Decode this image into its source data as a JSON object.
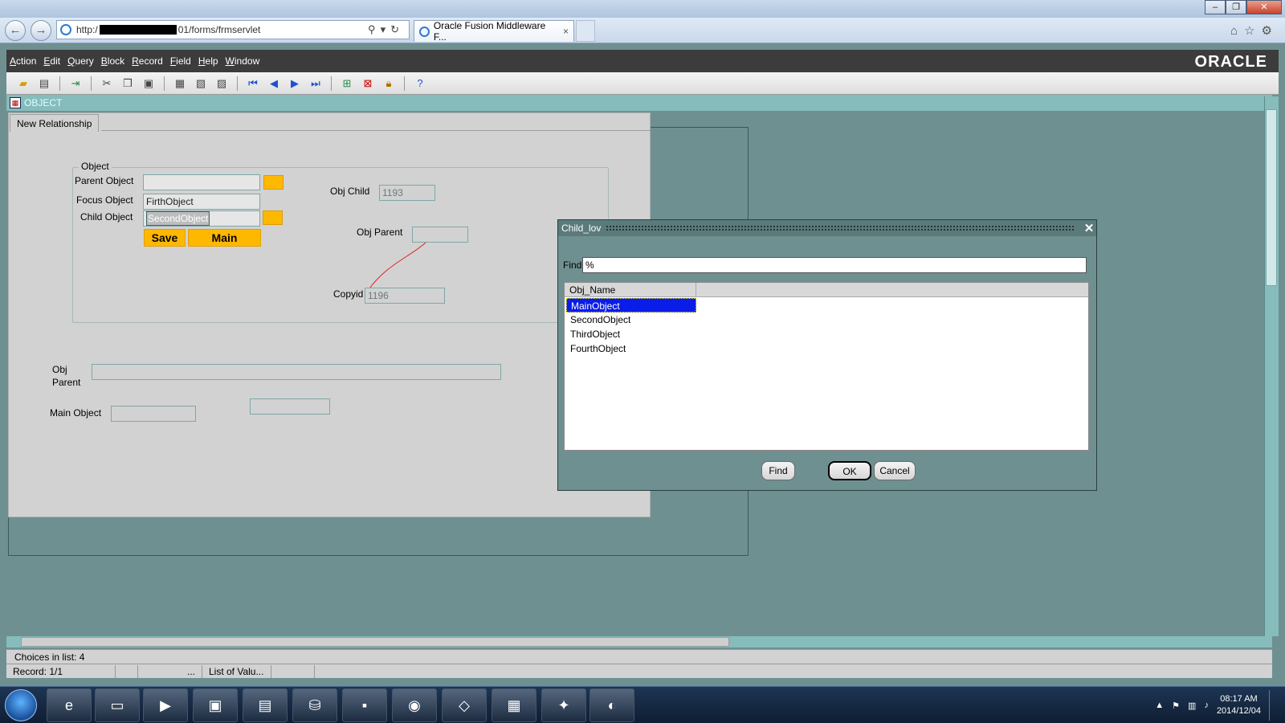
{
  "browser": {
    "url_prefix": "http:/",
    "url_suffix": "01/forms/frmservlet",
    "tab_title": "Oracle Fusion Middleware F...",
    "tab_close": "×",
    "window_buttons": {
      "minimize": "–",
      "maximize": "❐",
      "close": "✕"
    },
    "nav_back": "←",
    "nav_forward": "→",
    "address_tools": "⚲▾↻",
    "right_tools": "⌂☆⚙"
  },
  "app": {
    "menus": [
      "Action",
      "Edit",
      "Query",
      "Block",
      "Record",
      "Field",
      "Help",
      "Window"
    ],
    "menu_accel": [
      "A",
      "E",
      "Q",
      "B",
      "R",
      "F",
      "H",
      "W"
    ],
    "menu_rest": [
      "ction",
      "dit",
      "uery",
      "lock",
      "ecord",
      "ield",
      "elp",
      "indow"
    ],
    "logo": "ORACLE",
    "window_title": "OBJECT",
    "toolbar_icons": [
      "open-icon",
      "print-icon",
      "exit-icon",
      "cut-icon",
      "copy-icon",
      "paste-icon",
      "enter-query-icon",
      "execute-query-icon",
      "cancel-query-icon",
      "first-record-icon",
      "previous-record-icon",
      "next-record-icon",
      "last-record-icon",
      "insert-record-icon",
      "delete-record-icon",
      "lock-record-icon",
      "help-icon"
    ],
    "toolbar_help": "?"
  },
  "form": {
    "tab_label": "New Relationship",
    "group_label": "Object",
    "parent_object_label": "Parent Object",
    "parent_object_value": "",
    "focus_object_label": "Focus Object",
    "focus_object_value": "FirthObject",
    "child_object_label": "Child Object",
    "child_object_value": "SecondObject",
    "save_label": "Save",
    "main_label": "Main",
    "obj_child_label": "Obj Child",
    "obj_child_value": "1193",
    "obj_parent_label": "Obj Parent",
    "obj_parent_value": "",
    "copyid_label": "Copyid",
    "copyid_value": "1196",
    "obj_parent2_label_line1": "Obj",
    "obj_parent2_label_line2": "Parent",
    "main_object_label": "Main Object"
  },
  "lov": {
    "title": "Child_lov",
    "close_glyph": "✕",
    "find_label": "Find",
    "find_value": "%",
    "column_header": "Obj_Name",
    "items": [
      "MainObject",
      "SecondObject",
      "ThirdObject",
      "FourthObject"
    ],
    "selected_index": 0,
    "find_button": "Find",
    "ok_button": "OK",
    "cancel_button": "Cancel"
  },
  "status": {
    "message": "Choices in list: 4",
    "record": "Record: 1/1",
    "ellipsis": "...",
    "mode": "List of Valu..."
  },
  "taskbar": {
    "time": "08:17 AM",
    "date": "2014/12/04",
    "apps": [
      "internet-explorer-icon",
      "file-explorer-icon",
      "media-player-icon",
      "remote-desktop-icon",
      "task-manager-icon",
      "database-icon",
      "command-prompt-icon",
      "frog-app-icon",
      "notes-icon",
      "calendar-icon",
      "tool-icon",
      "paint-icon"
    ]
  }
}
